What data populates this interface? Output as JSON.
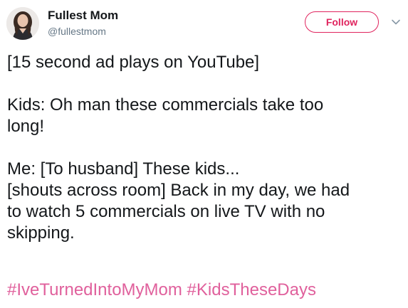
{
  "author": {
    "display_name": "Fullest Mom",
    "handle": "@fullestmom",
    "avatar_icon": "profile-photo-avatar"
  },
  "follow_button": {
    "label": "Follow",
    "color": "#e0245e"
  },
  "menu": {
    "icon": "chevron-down-icon"
  },
  "tweet": {
    "lines": [
      "[15 second ad plays on YouTube]",
      "",
      "Kids: Oh man these commercials take too",
      "long!",
      "",
      "Me: [To husband] These kids...",
      "[shouts across room] Back in my day, we had",
      "to watch 5 commercials on live TV with no",
      "skipping."
    ],
    "hashtags": [
      "#IveTurnedIntoMyMom",
      "#KidsTheseDays"
    ],
    "hashtag_color": "#e0609c"
  }
}
